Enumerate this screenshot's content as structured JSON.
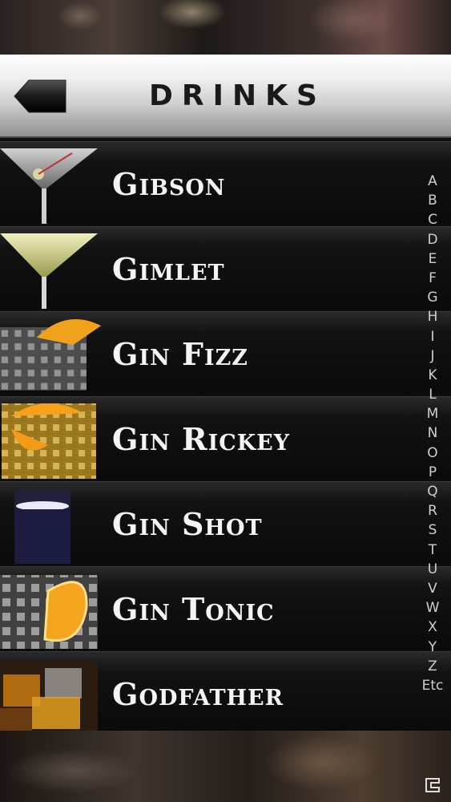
{
  "nav": {
    "title": "DRINKS",
    "back_label": ""
  },
  "drinks": [
    {
      "name": "Gibson"
    },
    {
      "name": "Gimlet"
    },
    {
      "name": "Gin Fizz"
    },
    {
      "name": "Gin Rickey"
    },
    {
      "name": "Gin Shot"
    },
    {
      "name": "Gin Tonic"
    },
    {
      "name": "Godfather"
    }
  ],
  "index": [
    "A",
    "B",
    "C",
    "D",
    "E",
    "F",
    "G",
    "H",
    "I",
    "J",
    "K",
    "L",
    "M",
    "N",
    "O",
    "P",
    "Q",
    "R",
    "S",
    "T",
    "U",
    "V",
    "W",
    "X",
    "Y",
    "Z",
    "Etc"
  ],
  "colors": {
    "text": "#f4f4f4",
    "nav_title": "#1a1a1a",
    "index": "#cfcfcf"
  }
}
